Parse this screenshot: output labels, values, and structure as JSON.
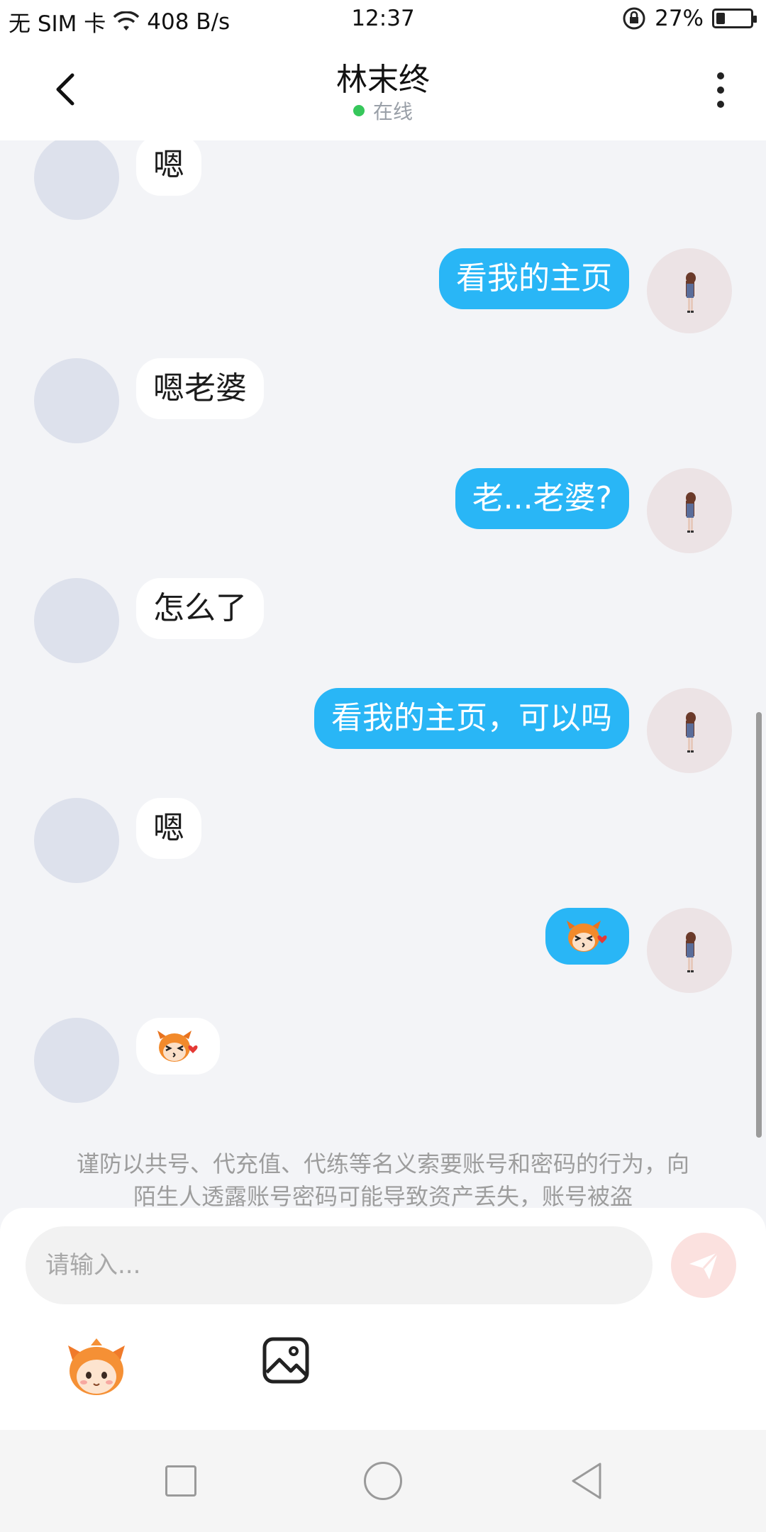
{
  "status_bar": {
    "carrier": "无 SIM 卡",
    "speed": "408 B/s",
    "time": "12:37",
    "battery": "27%",
    "battery_level": 0.27
  },
  "header": {
    "title": "林末终",
    "status": "在线"
  },
  "messages": [
    {
      "side": "in",
      "text": "嗯"
    },
    {
      "side": "out",
      "text": "看我的主页"
    },
    {
      "side": "in",
      "text": "嗯老婆"
    },
    {
      "side": "out",
      "text": "老...老婆?"
    },
    {
      "side": "in",
      "text": "怎么了"
    },
    {
      "side": "out",
      "text": "看我的主页，可以吗"
    },
    {
      "side": "in",
      "text": "嗯"
    },
    {
      "side": "out",
      "sticker": "kiss-sticker-icon"
    },
    {
      "side": "in",
      "sticker": "kiss-sticker-icon"
    }
  ],
  "notice": "谨防以共号、代充值、代练等名义索要账号和密码的行为，向陌生人透露账号密码可能导致资产丢失，账号被盗",
  "composer": {
    "placeholder": "请输入..."
  },
  "colors": {
    "outgoing_bubble": "#29b6f6",
    "incoming_bubble": "#ffffff",
    "online_dot": "#36c75b",
    "send_button": "#fbe1df"
  },
  "icons": {
    "back": "chevron-left-icon",
    "more": "more-vertical-icon",
    "send": "send-icon",
    "emoji": "emoji-icon",
    "image": "image-icon",
    "nav_recent": "recent-apps-icon",
    "nav_home": "home-icon",
    "nav_back": "back-triangle-icon"
  }
}
